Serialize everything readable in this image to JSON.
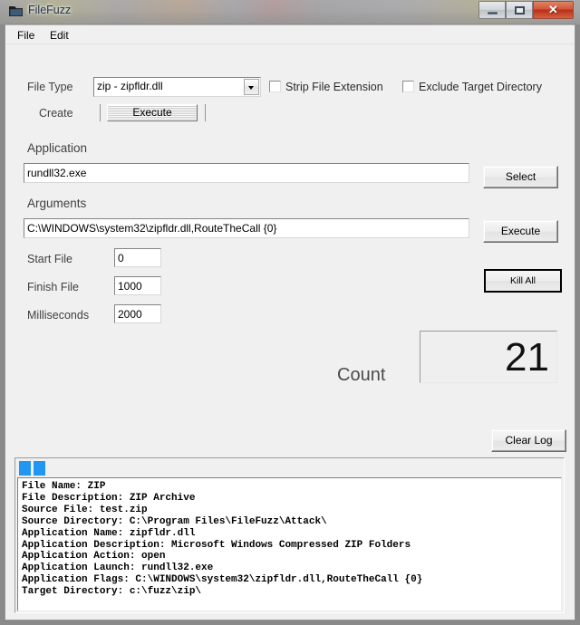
{
  "window": {
    "title": "FileFuzz",
    "icon": "folder-icon",
    "controls": {
      "minimize": "minimize-icon",
      "maximize": "maximize-icon",
      "close": "✕"
    }
  },
  "menu": {
    "items": [
      {
        "label": "File"
      },
      {
        "label": "Edit"
      }
    ]
  },
  "form": {
    "file_type": {
      "label": "File Type",
      "value": "zip - zipfldr.dll"
    },
    "create": {
      "label": "Create",
      "button_label": "Execute"
    },
    "strip_file_extension": {
      "label": "Strip File Extension",
      "checked": false
    },
    "exclude_target_directory": {
      "label": "Exclude Target Directory",
      "checked": false
    },
    "application": {
      "label": "Application",
      "value": "rundll32.exe",
      "select_button": "Select"
    },
    "arguments": {
      "label": "Arguments",
      "value": "C:\\WINDOWS\\system32\\zipfldr.dll,RouteTheCall {0}",
      "execute_button": "Execute"
    },
    "start_file": {
      "label": "Start File",
      "value": "0"
    },
    "finish_file": {
      "label": "Finish File",
      "value": "1000"
    },
    "milliseconds": {
      "label": "Milliseconds",
      "value": "2000"
    },
    "kill_all_button": "Kill All",
    "count": {
      "label": "Count",
      "value": "21"
    },
    "clear_log_button": "Clear Log"
  },
  "log": {
    "lines": [
      "File Name: ZIP",
      "File Description: ZIP Archive",
      "Source File: test.zip",
      "Source Directory: C:\\Program Files\\FileFuzz\\Attack\\",
      "Application Name: zipfldr.dll",
      "Application Description: Microsoft Windows Compressed ZIP Folders",
      "Application Action: open",
      "Application Launch: rundll32.exe",
      "Application Flags: C:\\WINDOWS\\system32\\zipfldr.dll,RouteTheCall {0}",
      "Target Directory: c:\\fuzz\\zip\\"
    ],
    "indicator_color": "#2196f3"
  },
  "colors": {
    "face": "#f0f0f0",
    "accent": "#2196f3",
    "close_button": "#c83a1c"
  }
}
